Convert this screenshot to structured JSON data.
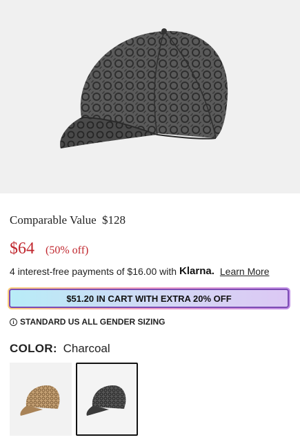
{
  "product": {
    "image_icon": "baseball-cap-image",
    "comparable_label": "Comparable Value",
    "comparable_amount": "$128",
    "price": "$64",
    "discount": "(50% off)",
    "klarna_text": "4 interest-free payments of $16.00 with",
    "klarna_brand": "Klarna.",
    "learn_more": "Learn More",
    "promo": "$51.20 IN CART WITH EXTRA 20% OFF",
    "sizing_icon": "info-icon",
    "sizing": "STANDARD US ALL GENDER SIZING",
    "color_label": "COLOR:",
    "color_value": "Charcoal",
    "swatches": [
      {
        "name": "khaki-cap-swatch",
        "selected": false,
        "color": "#b89466"
      },
      {
        "name": "charcoal-cap-swatch",
        "selected": true,
        "color": "#3a3a3a"
      }
    ],
    "colors": {
      "price_red": "#c0262d",
      "promo_border": "#7b4bb4",
      "cap_charcoal": "#3e3e3e"
    }
  }
}
